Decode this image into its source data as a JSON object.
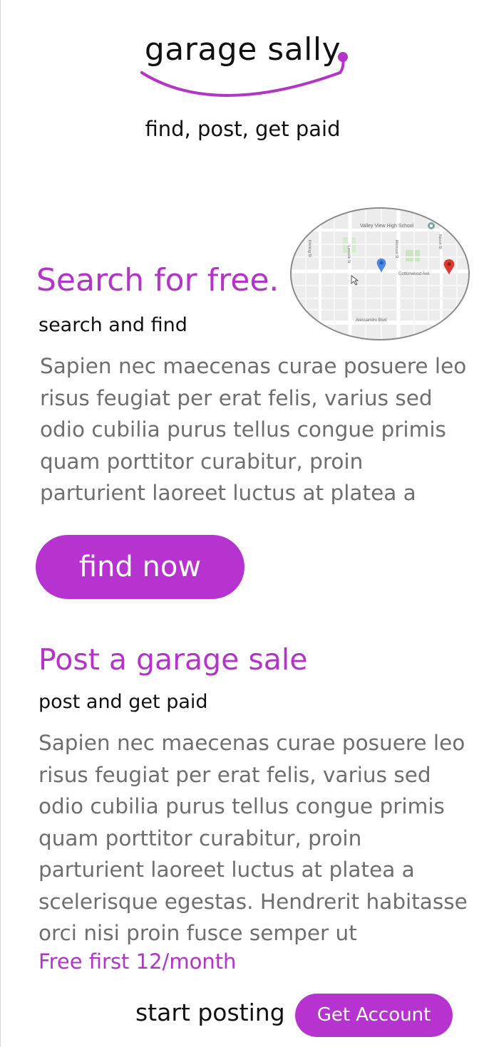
{
  "header": {
    "logo_text": "garage sally",
    "tagline": "find, post, get paid"
  },
  "search_section": {
    "title": "Search for free.",
    "subtitle": "search and find",
    "body_lines": [
      "Sapien nec maecenas curae posuere leo",
      "risus feugiat per erat felis, varius sed",
      "odio cubilia purus tellus congue primis",
      "quam porttitor curabitur, proin",
      "parturient laoreet luctus at platea a"
    ],
    "button_label": "find now",
    "map": {
      "labels": {
        "school": "Valley View High School",
        "avenue": "Cottonwood Ave",
        "boulevard": "Alessandro Blvd",
        "street_left": "Kitching St",
        "street_mid": "Lasselle St",
        "street_right": "Morrison St",
        "street_far": "Nason St",
        "corner": "Ave"
      }
    }
  },
  "post_section": {
    "title": "Post a garage sale",
    "subtitle": "post and get paid",
    "body_lines": [
      "Sapien nec maecenas curae posuere leo",
      "risus feugiat per erat felis, varius sed",
      "odio cubilia purus tellus congue primis",
      "quam porttitor curabitur, proin",
      "parturient laoreet luctus at platea a",
      "scelerisque egestas. Hendrerit habitasse",
      "orci nisi proin fusce semper ut"
    ],
    "pricing_note": "Free first 12/month",
    "cta_label": "start posting",
    "account_button_label": "Get Account"
  },
  "colors": {
    "accent": "#b733cf",
    "heading": "#b433c8",
    "body_text": "#6e6e6e",
    "text": "#111111"
  },
  "icons": {
    "logo_arc": "smile-arc-icon",
    "map_pin_blue": "map-pin-icon",
    "map_pin_red": "map-pin-icon",
    "cursor": "cursor-icon",
    "school_pin": "location-icon"
  }
}
